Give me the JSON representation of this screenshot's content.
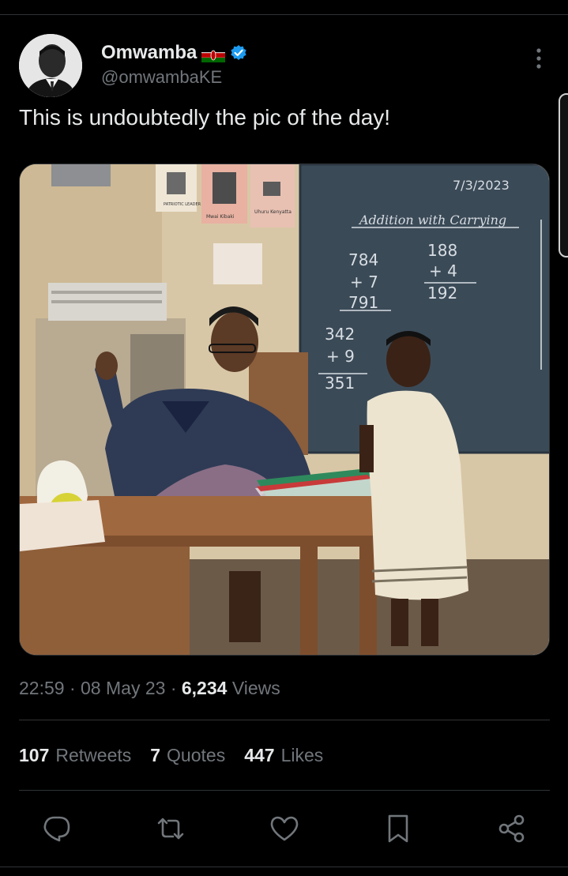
{
  "tweet": {
    "author": {
      "display_name": "Omwamba",
      "handle": "@omwambaKE",
      "flag_icon": "kenya-flag-icon",
      "verified_icon": "verified-badge-icon",
      "verified_color": "#1d9bf0"
    },
    "text": "This is undoubtedly the pic of the day!",
    "media": {
      "board_date": "7/3/2023",
      "board_title": "Addition with Carrying",
      "sums": [
        {
          "a": "784",
          "b": "+ 7",
          "total": "791"
        },
        {
          "a": "188",
          "b": "+ 4",
          "total": "192"
        },
        {
          "a": "342",
          "b": "+ 9",
          "total": "351"
        }
      ],
      "posters": [
        "PATRIOTIC LEADER",
        "Mwai Kibaki",
        "Uhuru Kenyatta"
      ]
    },
    "meta": {
      "time": "22:59",
      "separator": "·",
      "date": "08 May 23",
      "views_count": "6,234",
      "views_label": "Views"
    },
    "stats": [
      {
        "count": "107",
        "label": "Retweets"
      },
      {
        "count": "7",
        "label": "Quotes"
      },
      {
        "count": "447",
        "label": "Likes"
      }
    ]
  },
  "actions": [
    {
      "name": "reply",
      "icon": "reply-icon"
    },
    {
      "name": "retweet",
      "icon": "retweet-icon"
    },
    {
      "name": "like",
      "icon": "heart-icon"
    },
    {
      "name": "bookmark",
      "icon": "bookmark-icon"
    },
    {
      "name": "share",
      "icon": "share-icon"
    }
  ],
  "colors": {
    "background": "#000000",
    "text_primary": "#e7e9ea",
    "text_secondary": "#71767b",
    "divider": "#2f3336",
    "accent": "#1d9bf0"
  }
}
